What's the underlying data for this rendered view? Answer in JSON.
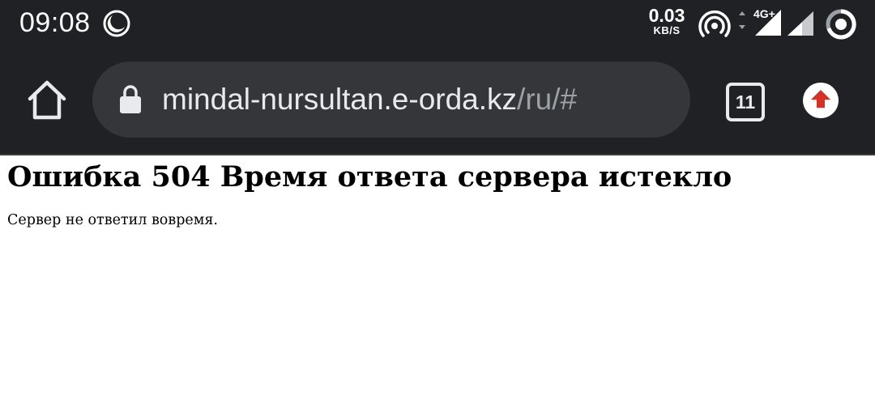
{
  "status_bar": {
    "time": "09:08",
    "net_speed_value": "0.03",
    "net_speed_unit": "KB/S",
    "network_type": "4G+",
    "icons": [
      "do-not-disturb-icon",
      "hotspot-icon",
      "signal-4g-icon",
      "signal-icon",
      "battery-icon"
    ]
  },
  "toolbar": {
    "url_host": "mindal-nursultan.e-orda.kz",
    "url_path": "/ru/#",
    "tab_count": "11",
    "colors": {
      "background": "#202124",
      "omnibox": "#35363a",
      "url_host": "#e8eaed",
      "url_path": "#9aa0a6",
      "update_badge": "#d93025"
    }
  },
  "page": {
    "title": "Ошибка 504 Время ответа сервера истекло",
    "message": "Сервер не ответил вовремя."
  }
}
